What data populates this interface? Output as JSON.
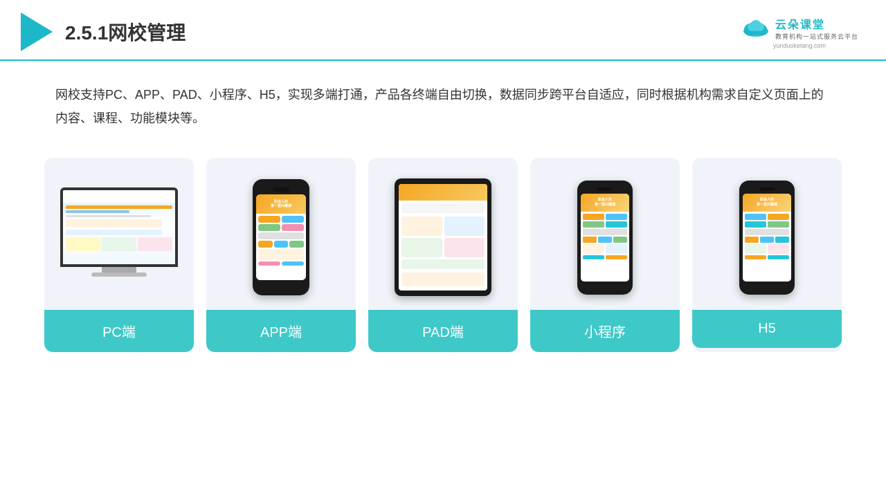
{
  "header": {
    "title": "2.5.1网校管理",
    "brand_name": "云朵课堂",
    "brand_tagline": "教育机构一站式服务云平台",
    "brand_url": "yunduoketang.com"
  },
  "description": "网校支持PC、APP、PAD、小程序、H5，实现多端打通，产品各终端自由切换，数据同步跨平台自适应，同时根据机构需求自定义页面上的内容、课程、功能模块等。",
  "cards": [
    {
      "label": "PC端",
      "type": "pc"
    },
    {
      "label": "APP端",
      "type": "phone"
    },
    {
      "label": "PAD端",
      "type": "ipad"
    },
    {
      "label": "小程序",
      "type": "phone-mini"
    },
    {
      "label": "H5",
      "type": "phone-mini2"
    }
  ]
}
